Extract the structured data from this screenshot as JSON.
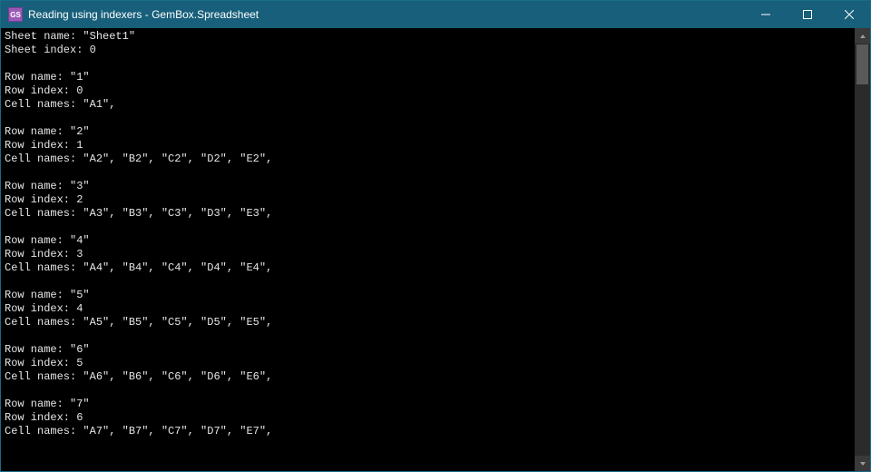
{
  "window": {
    "title": "Reading using indexers - GemBox.Spreadsheet",
    "icon_label": "GS"
  },
  "console": {
    "sheet_label": "Sheet name:",
    "sheet_name": "\"Sheet1\"",
    "sheet_index_label": "Sheet index:",
    "sheet_index": "0",
    "row_name_label": "Row name:",
    "row_index_label": "Row index:",
    "cell_names_label": "Cell names:",
    "rows": [
      {
        "name": "\"1\"",
        "index": "0",
        "cells": "\"A1\","
      },
      {
        "name": "\"2\"",
        "index": "1",
        "cells": "\"A2\", \"B2\", \"C2\", \"D2\", \"E2\","
      },
      {
        "name": "\"3\"",
        "index": "2",
        "cells": "\"A3\", \"B3\", \"C3\", \"D3\", \"E3\","
      },
      {
        "name": "\"4\"",
        "index": "3",
        "cells": "\"A4\", \"B4\", \"C4\", \"D4\", \"E4\","
      },
      {
        "name": "\"5\"",
        "index": "4",
        "cells": "\"A5\", \"B5\", \"C5\", \"D5\", \"E5\","
      },
      {
        "name": "\"6\"",
        "index": "5",
        "cells": "\"A6\", \"B6\", \"C6\", \"D6\", \"E6\","
      },
      {
        "name": "\"7\"",
        "index": "6",
        "cells": "\"A7\", \"B7\", \"C7\", \"D7\", \"E7\","
      }
    ]
  }
}
